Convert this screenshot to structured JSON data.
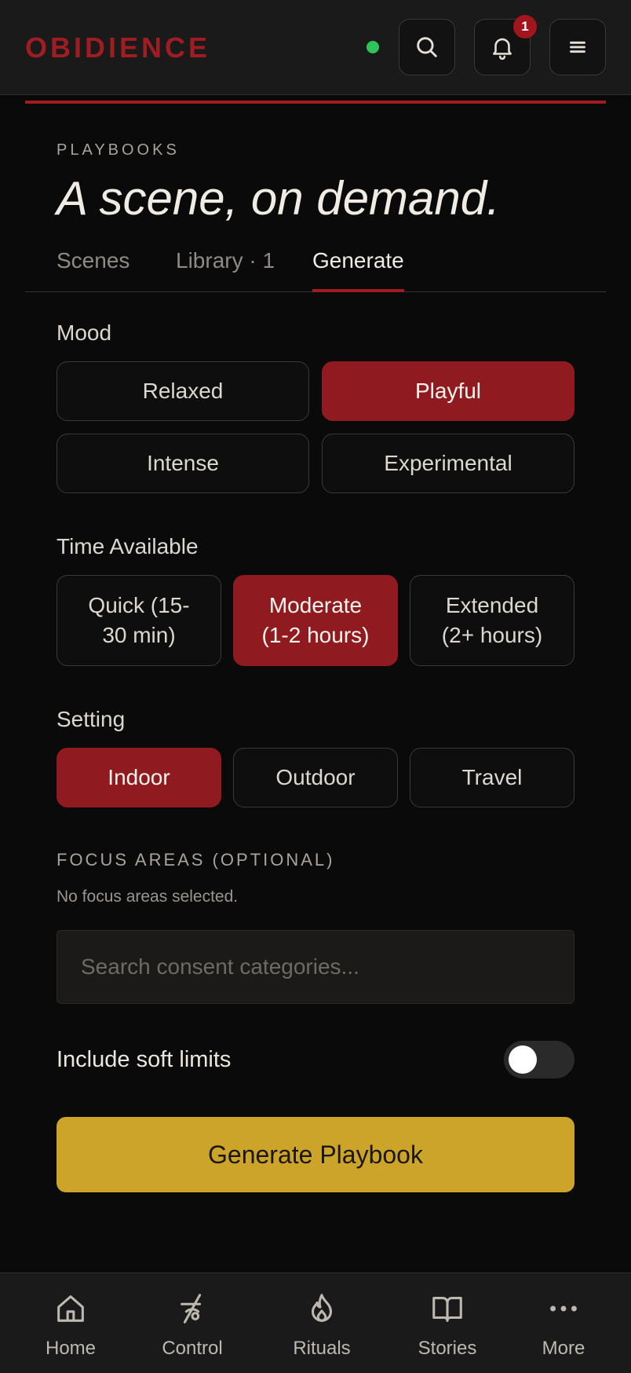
{
  "header": {
    "brand": "OBIDIENCE",
    "notifications_count": "1",
    "status_color": "#2ec45a",
    "icons": [
      "search-icon",
      "bell-icon",
      "menu-icon"
    ]
  },
  "page": {
    "eyebrow": "PLAYBOOKS",
    "title": "A scene, on demand.",
    "tabs": [
      {
        "label": "Scenes",
        "active": false
      },
      {
        "label": "Library · 1",
        "active": false
      },
      {
        "label": "Generate",
        "active": true
      }
    ]
  },
  "mood": {
    "label": "Mood",
    "options": [
      {
        "label": "Relaxed",
        "selected": false
      },
      {
        "label": "Playful",
        "selected": true
      },
      {
        "label": "Intense",
        "selected": false
      },
      {
        "label": "Experimental",
        "selected": false
      }
    ]
  },
  "time": {
    "label": "Time Available",
    "options": [
      {
        "line1": "Quick (15-",
        "line2": "30 min)",
        "selected": false
      },
      {
        "line1": "Moderate",
        "line2": "(1-2 hours)",
        "selected": true
      },
      {
        "line1": "Extended",
        "line2": "(2+ hours)",
        "selected": false
      }
    ]
  },
  "setting": {
    "label": "Setting",
    "options": [
      {
        "label": "Indoor",
        "selected": true
      },
      {
        "label": "Outdoor",
        "selected": false
      },
      {
        "label": "Travel",
        "selected": false
      }
    ]
  },
  "focus": {
    "label": "FOCUS AREAS (OPTIONAL)",
    "note": "No focus areas selected.",
    "search_placeholder": "Search consent categories...",
    "search_value": ""
  },
  "soft_limits": {
    "label": "Include soft limits",
    "enabled": false
  },
  "cta": {
    "label": "Generate Playbook"
  },
  "colors": {
    "accent_red": "#9e1c22",
    "cta_gold": "#cca42a",
    "background": "#0a0a0a"
  },
  "bottom_nav": [
    {
      "label": "Home",
      "icon": "home-icon"
    },
    {
      "label": "Control",
      "icon": "control-icon"
    },
    {
      "label": "Rituals",
      "icon": "flame-icon"
    },
    {
      "label": "Stories",
      "icon": "book-icon"
    },
    {
      "label": "More",
      "icon": "more-icon"
    }
  ]
}
